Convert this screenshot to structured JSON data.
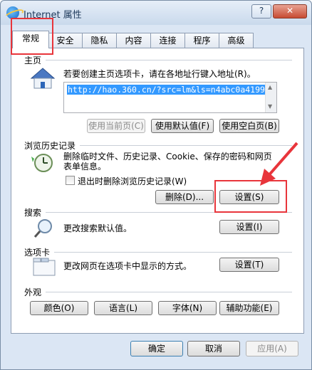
{
  "window": {
    "title": "Internet 属性",
    "help": "?",
    "close": "✕"
  },
  "tabs": [
    "常规",
    "安全",
    "隐私",
    "内容",
    "连接",
    "程序",
    "高级"
  ],
  "homepage": {
    "title": "主页",
    "description": "若要创建主页选项卡，请在各地址行键入地址(R)。",
    "url": "http://hao.360.cn/?src=lm&ls=n4abc0a4199",
    "buttons": [
      "使用当前页(C)",
      "使用默认值(F)",
      "使用空白页(B)"
    ]
  },
  "history": {
    "title": "浏览历史记录",
    "description_line1": "删除临时文件、历史记录、Cookie、保存的密码和网页",
    "description_line2": "表单信息。",
    "checkbox_label": "退出时删除浏览历史记录(W)",
    "checkbox_checked": false,
    "delete_button": "删除(D)...",
    "settings_button": "设置(S)"
  },
  "search": {
    "title": "搜索",
    "description": "更改搜索默认值。",
    "settings_button": "设置(I)"
  },
  "tabs_section": {
    "title": "选项卡",
    "description": "更改网页在选项卡中显示的方式。",
    "settings_button": "设置(T)"
  },
  "appearance": {
    "title": "外观",
    "buttons": [
      "颜色(O)",
      "语言(L)",
      "字体(N)",
      "辅助功能(E)"
    ]
  },
  "footer": {
    "ok": "确定",
    "cancel": "取消",
    "apply": "应用(A)"
  },
  "colors": {
    "highlight": "#e8353b",
    "selection": "#3399ff"
  }
}
